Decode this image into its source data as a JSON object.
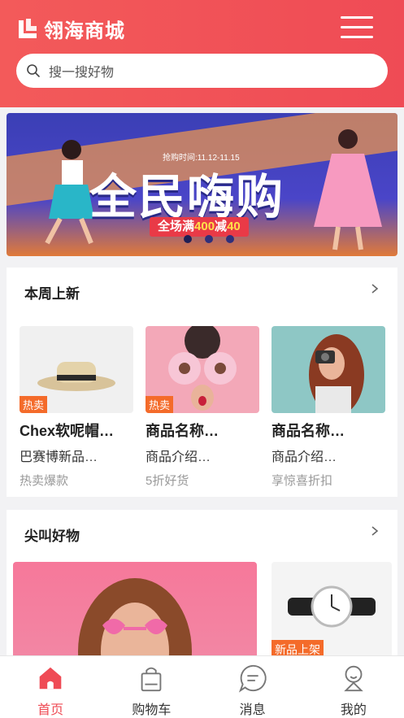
{
  "header": {
    "logo_text": "翎海商城",
    "search_placeholder": "搜一搜好物"
  },
  "banner": {
    "time_text": "抢购时间:11.12-11.15",
    "title": "全民嗨购",
    "promo_prefix": "全场满",
    "promo_a": "400",
    "promo_mid": "减",
    "promo_b": "40"
  },
  "sections": {
    "new": {
      "title": "本周上新",
      "products": [
        {
          "tag": "热卖",
          "name": "Chex软呢帽…",
          "desc": "巴赛博新品…",
          "hint": "热卖爆款"
        },
        {
          "tag": "热卖",
          "name": "商品名称…",
          "desc": "商品介绍…",
          "hint": "5折好货"
        },
        {
          "tag": "",
          "name": "商品名称…",
          "desc": "商品介绍…",
          "hint": "享惊喜折扣"
        }
      ]
    },
    "hot": {
      "title": "尖叫好物",
      "small_tag": "新品上架"
    }
  },
  "tabbar": {
    "items": [
      {
        "label": "首页",
        "icon": "home-icon",
        "active": true
      },
      {
        "label": "购物车",
        "icon": "shopping-bag-icon",
        "active": false
      },
      {
        "label": "消息",
        "icon": "message-icon",
        "active": false
      },
      {
        "label": "我的",
        "icon": "profile-icon",
        "active": false
      }
    ]
  },
  "colors": {
    "brand": "#ef4b55",
    "tag": "#f46b2a"
  }
}
